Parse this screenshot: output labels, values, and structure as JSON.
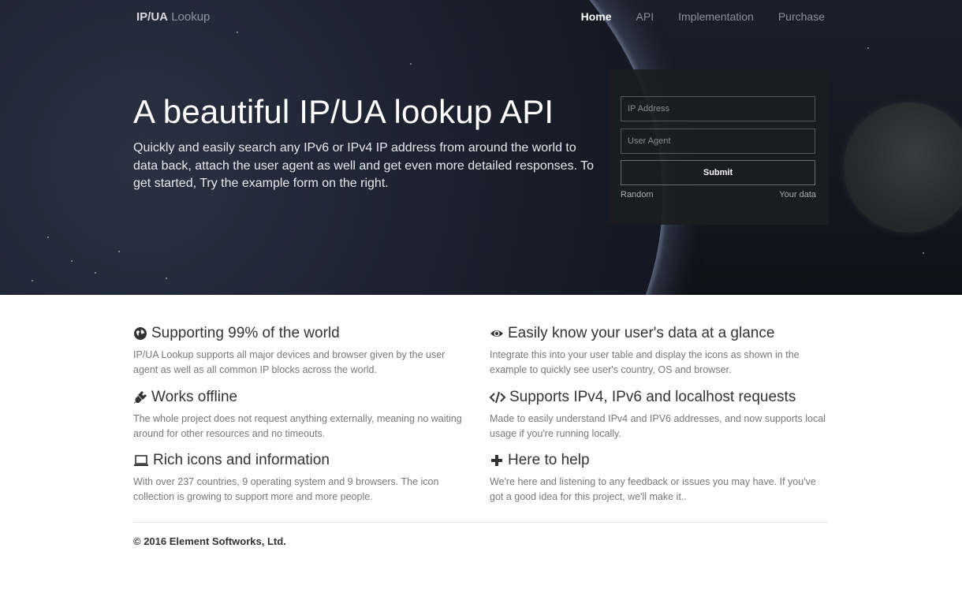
{
  "brand": {
    "bold": "IP/UA",
    "light": "Lookup"
  },
  "nav": [
    {
      "label": "Home",
      "active": true
    },
    {
      "label": "API",
      "active": false
    },
    {
      "label": "Implementation",
      "active": false
    },
    {
      "label": "Purchase",
      "active": false
    }
  ],
  "hero": {
    "title": "A beautiful IP/UA lookup API",
    "subtitle": "Quickly and easily search any IPv6 or IPv4 IP address from around the world to data back, attach the user agent as well and get even more detailed responses. To get started, Try the example form on the right."
  },
  "form": {
    "ip_placeholder": "IP Address",
    "ua_placeholder": "User Agent",
    "submit_label": "Submit",
    "random_link": "Random",
    "yourdata_link": "Your data"
  },
  "features": [
    {
      "icon": "globe-icon",
      "title": "Supporting 99% of the world",
      "text": "IP/UA Lookup supports all major devices and browser given by the user agent as well as all common IP blocks across the world."
    },
    {
      "icon": "eye-icon",
      "title": "Easily know your user's data at a glance",
      "text": "Integrate this into your user table and display the icons as shown in the example to quickly see user's country, OS and browser."
    },
    {
      "icon": "plug-icon",
      "title": "Works offline",
      "text": "The whole project does not request anything externally, meaning no waiting around for other resources and no timeouts."
    },
    {
      "icon": "code-icon",
      "title": "Supports IPv4, IPv6 and localhost requests",
      "text": "Made to easily understand IPv4 and IPV6 addresses, and now supports local usage if you're running locally."
    },
    {
      "icon": "laptop-icon",
      "title": "Rich icons and information",
      "text": "With over 237 countries, 9 operating system and 9 browsers. The icon collection is growing to support more and more people."
    },
    {
      "icon": "plus-icon",
      "title": "Here to help",
      "text": "We're here and listening to any feedback or issues you may have. If you've got a good idea for this project, we'll make it.."
    }
  ],
  "footer": {
    "copyright": "© 2016 Element Softworks, Ltd."
  }
}
